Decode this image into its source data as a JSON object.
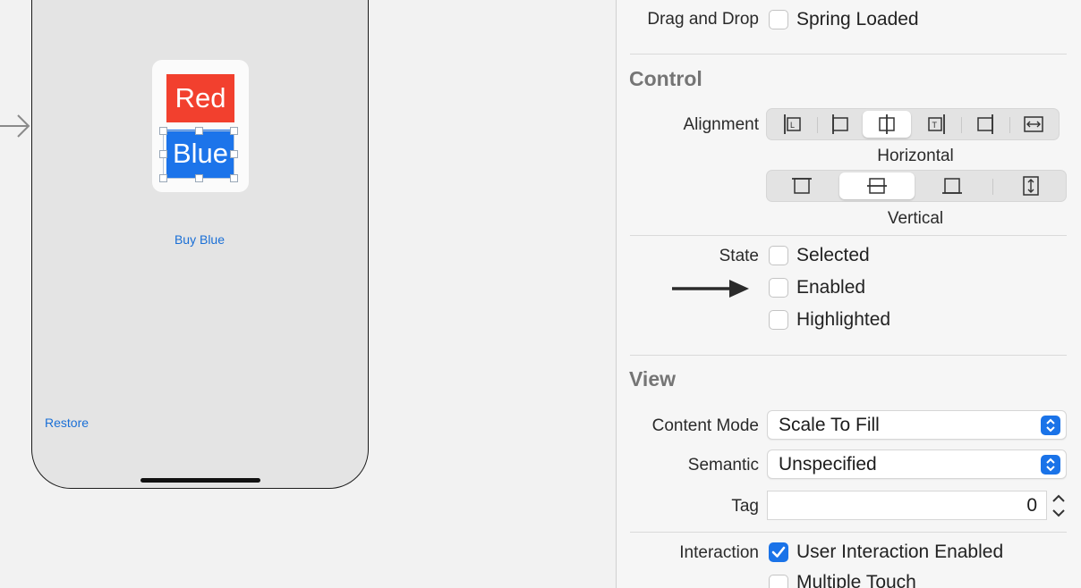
{
  "canvas": {
    "icon": {
      "red_text": "Red",
      "blue_text": "Blue"
    },
    "buy_blue_label": "Buy Blue",
    "restore_label": "Restore"
  },
  "inspector": {
    "drag_and_drop": {
      "label": "Drag and Drop",
      "option": "Spring Loaded",
      "checked": false
    },
    "control": {
      "title": "Control",
      "alignment_label": "Alignment",
      "horizontal_caption": "Horizontal",
      "vertical_caption": "Vertical",
      "horizontal_selected": "center",
      "vertical_selected": "center"
    },
    "state": {
      "label": "State",
      "options": [
        {
          "label": "Selected",
          "checked": false
        },
        {
          "label": "Enabled",
          "checked": false
        },
        {
          "label": "Highlighted",
          "checked": false
        }
      ]
    },
    "view": {
      "title": "View",
      "content_mode_label": "Content Mode",
      "content_mode_value": "Scale To Fill",
      "semantic_label": "Semantic",
      "semantic_value": "Unspecified",
      "tag_label": "Tag",
      "tag_value": "0",
      "interaction_label": "Interaction",
      "interaction_options": [
        {
          "label": "User Interaction Enabled",
          "checked": true
        },
        {
          "label": "Multiple Touch",
          "checked": false
        }
      ]
    }
  },
  "colors": {
    "accent": "#1a73e8",
    "red": "#f2402e",
    "blue": "#1c74ea",
    "link": "#1a6fd6"
  }
}
